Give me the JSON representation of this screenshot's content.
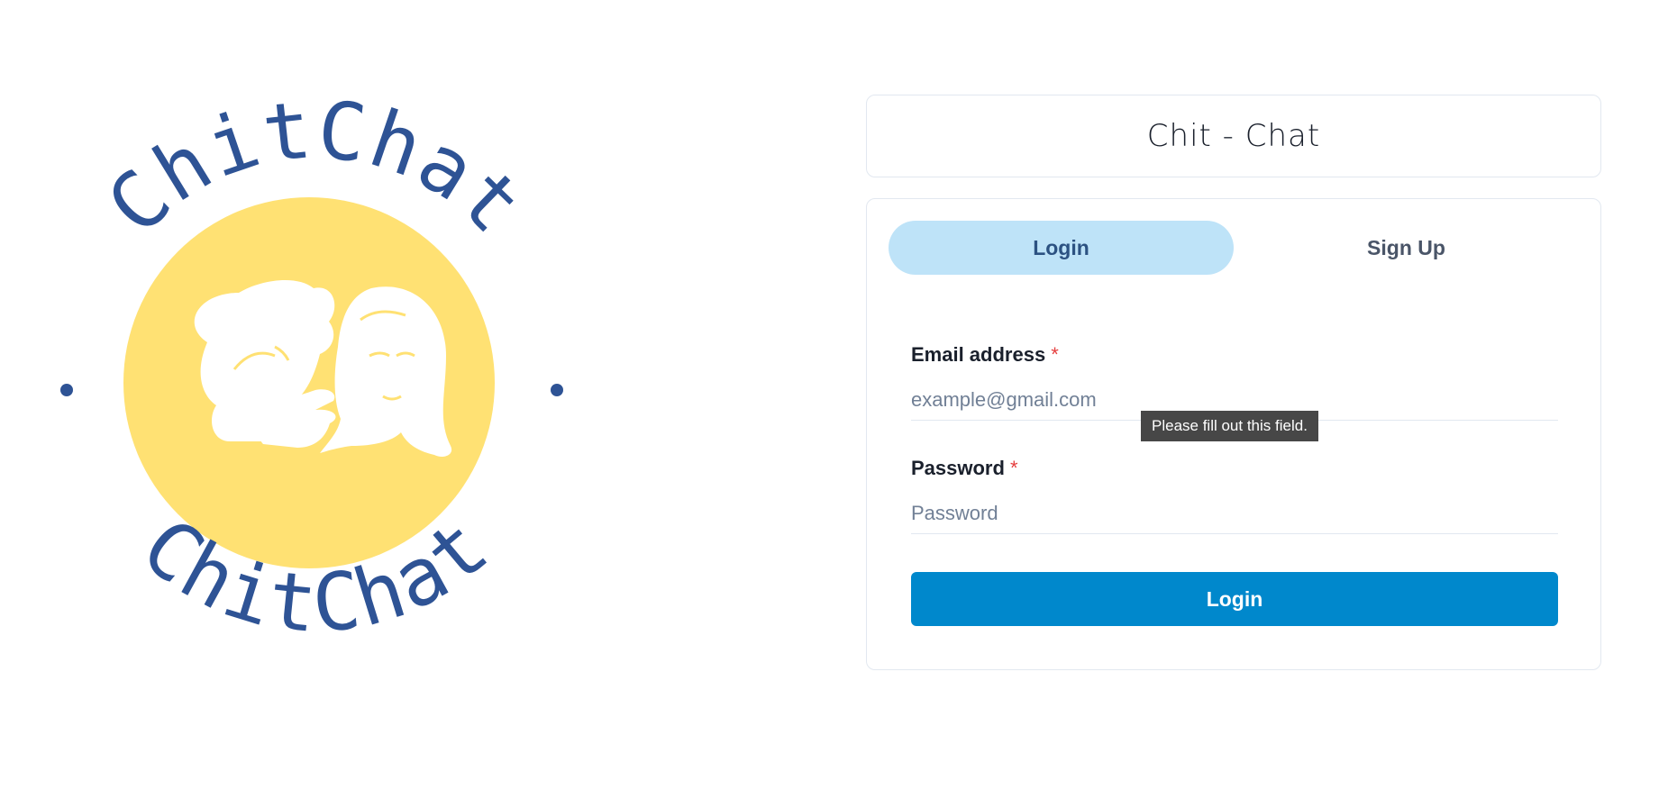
{
  "logo": {
    "top_text": "ChitChat",
    "bottom_text": "ChitChat",
    "circle_color": "#ffe173",
    "text_color": "#2e5395"
  },
  "header": {
    "title": "Chit - Chat"
  },
  "tabs": [
    {
      "label": "Login",
      "active": true
    },
    {
      "label": "Sign Up",
      "active": false
    }
  ],
  "form": {
    "email": {
      "label": "Email address",
      "required_mark": "*",
      "placeholder": "example@gmail.com",
      "value": ""
    },
    "password": {
      "label": "Password",
      "required_mark": "*",
      "placeholder": "Password",
      "value": ""
    },
    "tooltip": "Please fill out this field.",
    "submit_label": "Login"
  },
  "colors": {
    "accent": "#0088cc",
    "tab_active_bg": "#bee3f8",
    "required": "#e53e3e"
  }
}
